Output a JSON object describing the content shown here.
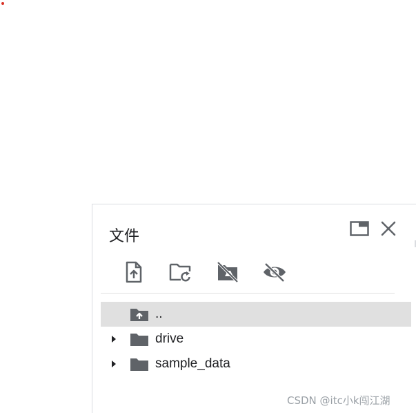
{
  "panel": {
    "title": "文件",
    "header_buttons": [
      {
        "name": "open-in-tab",
        "icon": "picture-in-picture-icon"
      },
      {
        "name": "close",
        "icon": "close-icon"
      }
    ],
    "toolbar": [
      {
        "name": "upload",
        "icon": "upload-file-icon"
      },
      {
        "name": "refresh",
        "icon": "folder-refresh-icon"
      },
      {
        "name": "mount-drive",
        "icon": "drive-off-icon"
      },
      {
        "name": "toggle-hidden",
        "icon": "eye-off-icon"
      }
    ],
    "tree": [
      {
        "label": "..",
        "icon": "folder-up-icon",
        "expandable": false,
        "selected": true
      },
      {
        "label": "drive",
        "icon": "folder-icon",
        "expandable": true,
        "selected": false
      },
      {
        "label": "sample_data",
        "icon": "folder-icon",
        "expandable": true,
        "selected": false
      }
    ]
  },
  "colors": {
    "icon": "#5f6368",
    "selected_row": "#e0e0e0",
    "text": "#202124"
  },
  "watermark": "CSDN @itc小k闯江湖"
}
